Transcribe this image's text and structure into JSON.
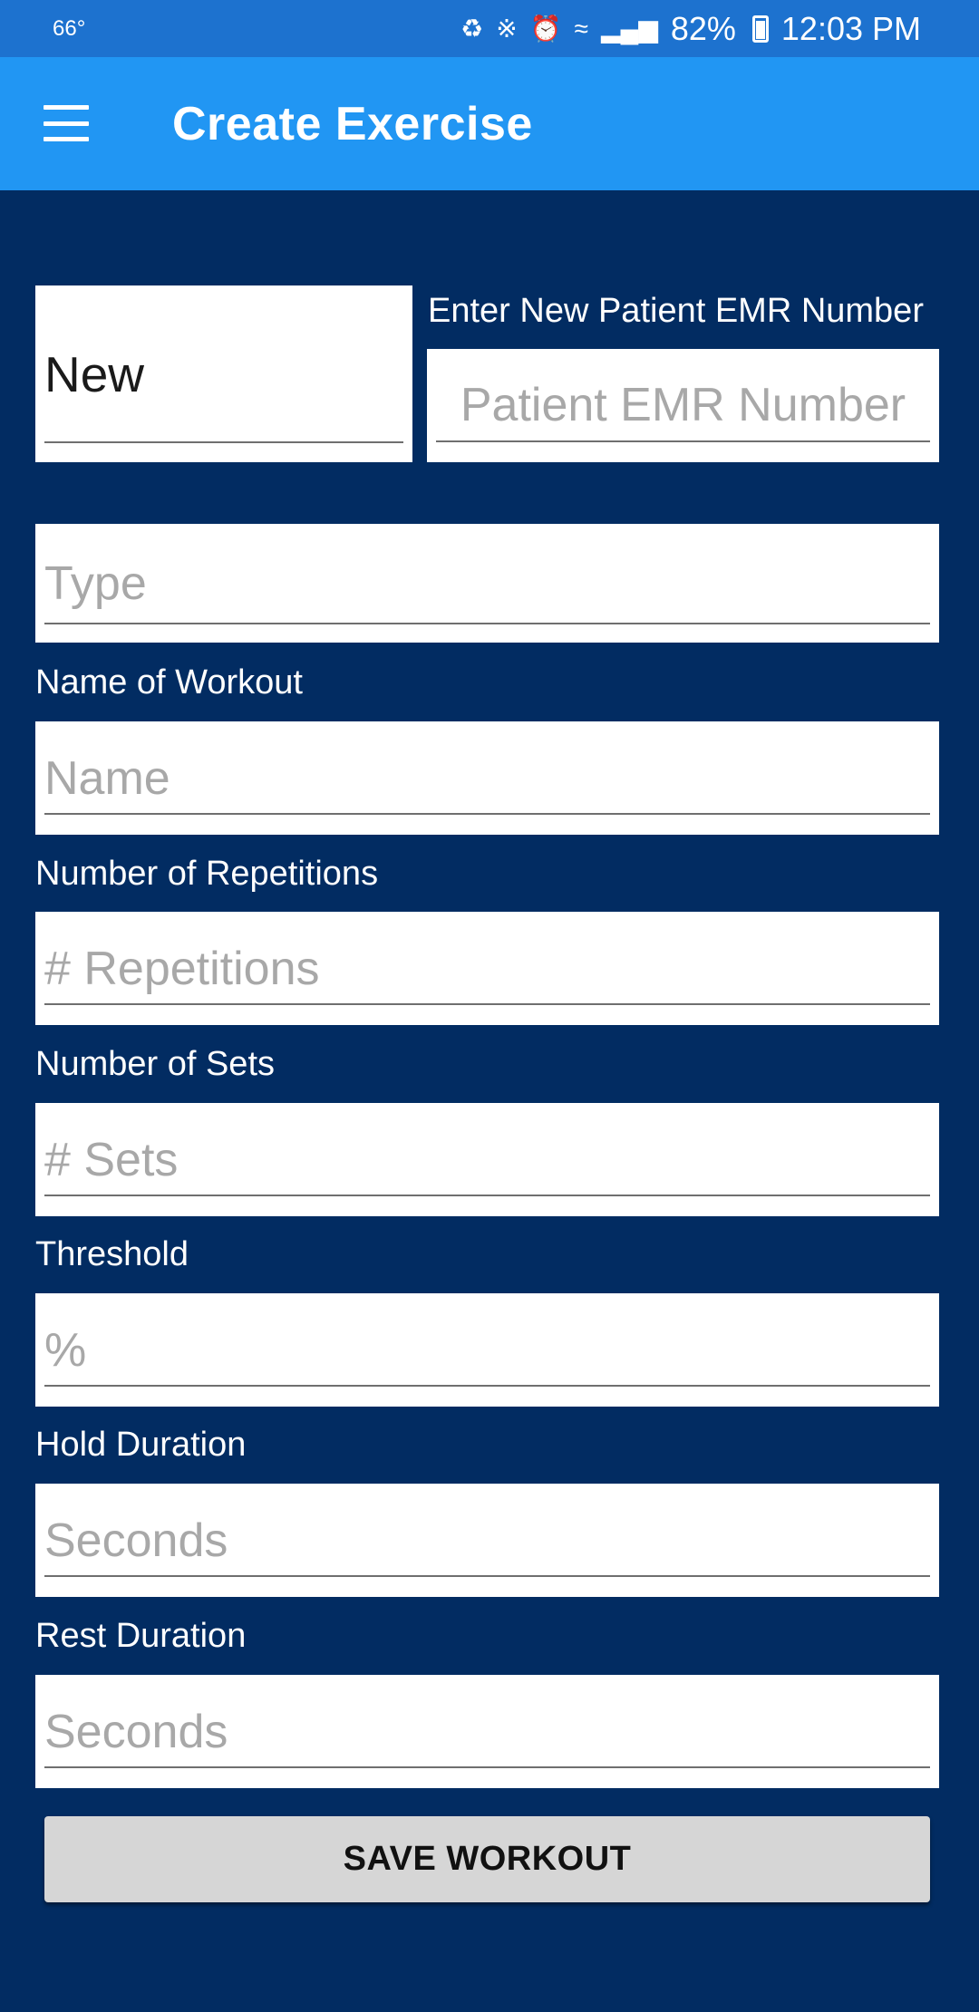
{
  "status_bar": {
    "temperature": "66°",
    "icons": [
      "battery-saver-icon",
      "bluetooth-icon",
      "alarm-icon",
      "wifi-icon",
      "signal-icon"
    ],
    "battery": "82%",
    "time": "12:03 PM"
  },
  "app_bar": {
    "menu_icon": "hamburger-menu-icon",
    "title": "Create Exercise"
  },
  "patient": {
    "select_value": "New",
    "emr_label": "Enter New Patient EMR Number",
    "emr_placeholder": "Patient EMR Number"
  },
  "form": {
    "type_placeholder": "Type",
    "name_label": "Name of Workout",
    "name_placeholder": "Name",
    "reps_label": "Number of Repetitions",
    "reps_placeholder": "# Repetitions",
    "sets_label": "Number of Sets",
    "sets_placeholder": "# Sets",
    "threshold_label": "Threshold",
    "threshold_placeholder": "%",
    "hold_label": "Hold Duration",
    "hold_placeholder": "Seconds",
    "rest_label": "Rest Duration",
    "rest_placeholder": "Seconds"
  },
  "save_label": "SAVE WORKOUT",
  "colors": {
    "status_bar": "#1d72cf",
    "app_bar": "#2196f3",
    "background": "#022c62",
    "button": "#d6d6d6"
  }
}
